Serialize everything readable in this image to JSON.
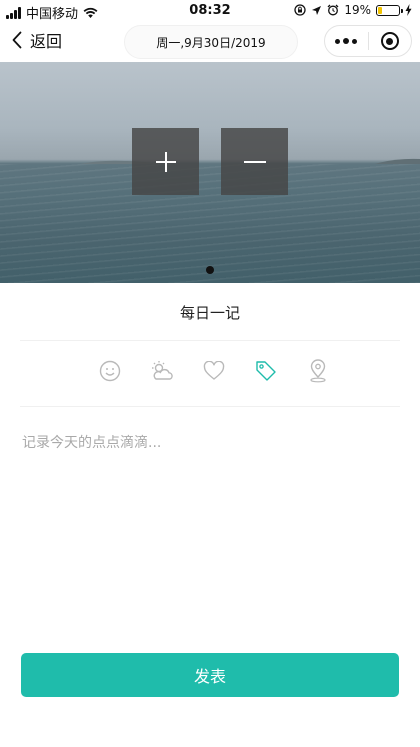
{
  "status_bar": {
    "carrier": "中国移动",
    "time": "08:32",
    "battery_percent": "19%",
    "battery_level": 0.19,
    "icons": [
      "signal-icon",
      "wifi-icon",
      "screen-lock-icon",
      "location-arrow-icon",
      "alarm-icon",
      "battery-icon",
      "charging-icon"
    ]
  },
  "nav": {
    "back_label": "返回",
    "date": "周一,9月30日/2019",
    "icons": [
      "back-chevron-icon",
      "more-dots-icon",
      "target-icon"
    ]
  },
  "banner": {
    "pager_count": 1,
    "active_page": 1,
    "icons": [
      "plus-icon",
      "minus-icon"
    ]
  },
  "page": {
    "title": "每日一记"
  },
  "toolbar": {
    "icons": [
      "smiley-icon",
      "weather-icon",
      "heart-icon",
      "tag-icon",
      "location-pin-icon"
    ],
    "active_color": "#1fbcab",
    "inactive_color": "#b9b9b9"
  },
  "editor": {
    "value": "",
    "placeholder": "记录今天的点点滴滴..."
  },
  "actions": {
    "submit_label": "发表",
    "submit_color": "#1fbcab"
  }
}
